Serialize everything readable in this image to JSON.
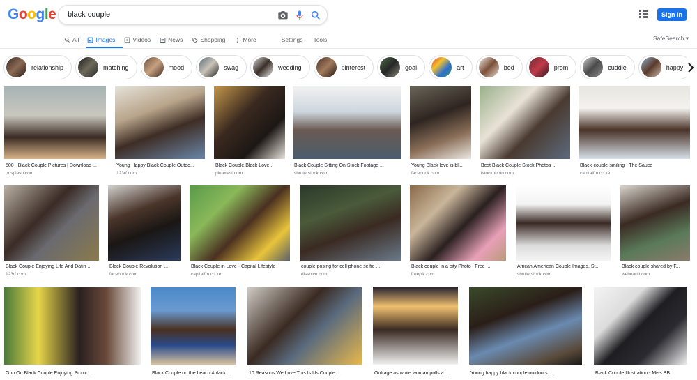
{
  "header": {
    "logo_letters": [
      "G",
      "o",
      "o",
      "g",
      "l",
      "e"
    ],
    "query": "black couple",
    "signin_label": "Sign in"
  },
  "tabs": [
    {
      "label": "All",
      "icon": "search-icon"
    },
    {
      "label": "Images",
      "icon": "image-icon",
      "active": true
    },
    {
      "label": "Videos",
      "icon": "video-icon"
    },
    {
      "label": "News",
      "icon": "news-icon"
    },
    {
      "label": "Shopping",
      "icon": "tag-icon"
    },
    {
      "label": "More",
      "icon": "more-vert-icon"
    },
    {
      "label": "Settings"
    },
    {
      "label": "Tools"
    }
  ],
  "safesearch_label": "SafeSearch ▾",
  "chips": [
    {
      "label": "relationship"
    },
    {
      "label": "matching"
    },
    {
      "label": "mood"
    },
    {
      "label": "swag"
    },
    {
      "label": "wedding"
    },
    {
      "label": "pinterest"
    },
    {
      "label": "goal"
    },
    {
      "label": "art"
    },
    {
      "label": "bed"
    },
    {
      "label": "prom"
    },
    {
      "label": "cuddle"
    },
    {
      "label": "happy"
    }
  ],
  "rows": [
    [
      {
        "caption": "500+ Black Couple Pictures | Download ...",
        "source": "unsplash.com"
      },
      {
        "caption": "Young Happy Black Couple Outdo...",
        "source": "123rf.com"
      },
      {
        "caption": "Black Couple Black Love...",
        "source": "pinterest.com"
      },
      {
        "caption": "Black Couple Sitting On Stock Footage ...",
        "source": "shutterstock.com"
      },
      {
        "caption": "Young Black love is bl...",
        "source": "facebook.com"
      },
      {
        "caption": "Best Black Couple Stock Photos ...",
        "source": "istockphoto.com"
      },
      {
        "caption": "Black-couple-smiling - The Sauce",
        "source": "capitalfm.co.ke"
      }
    ],
    [
      {
        "caption": "Black Couple Enjoying Life And Datin ...",
        "source": "123rf.com"
      },
      {
        "caption": "Black Couple Revolution ...",
        "source": "facebook.com"
      },
      {
        "caption": "Black Couple in Love - Capital Lifestyle",
        "source": "capitalfm.co.ke"
      },
      {
        "caption": "couple posing for cell phone selfie ...",
        "source": "dissolve.com"
      },
      {
        "caption": "Black couple in a city Photo | Free ...",
        "source": "freepik.com"
      },
      {
        "caption": "African American Couple Images, St...",
        "source": "shutterstock.com"
      },
      {
        "caption": "Black couple shared by F...",
        "source": "weheartit.com"
      }
    ],
    [
      {
        "caption": "Gun On Black Couple Enjoying Picnic ...",
        "source": ""
      },
      {
        "caption": "Black Couple on the beach #black...",
        "source": ""
      },
      {
        "caption": "10 Reasons We Love This Is Us Couple ...",
        "source": ""
      },
      {
        "caption": "Outrage as white woman pulls a ...",
        "source": ""
      },
      {
        "caption": "Young happy black couple outdoors ...",
        "source": ""
      },
      {
        "caption": "Black Couple Illustration - Miss BB",
        "source": ""
      }
    ]
  ],
  "colors": {
    "accent": "#1a73e8",
    "logo": [
      "#4285F4",
      "#EA4335",
      "#FBBC05",
      "#4285F4",
      "#34A853",
      "#EA4335"
    ]
  }
}
